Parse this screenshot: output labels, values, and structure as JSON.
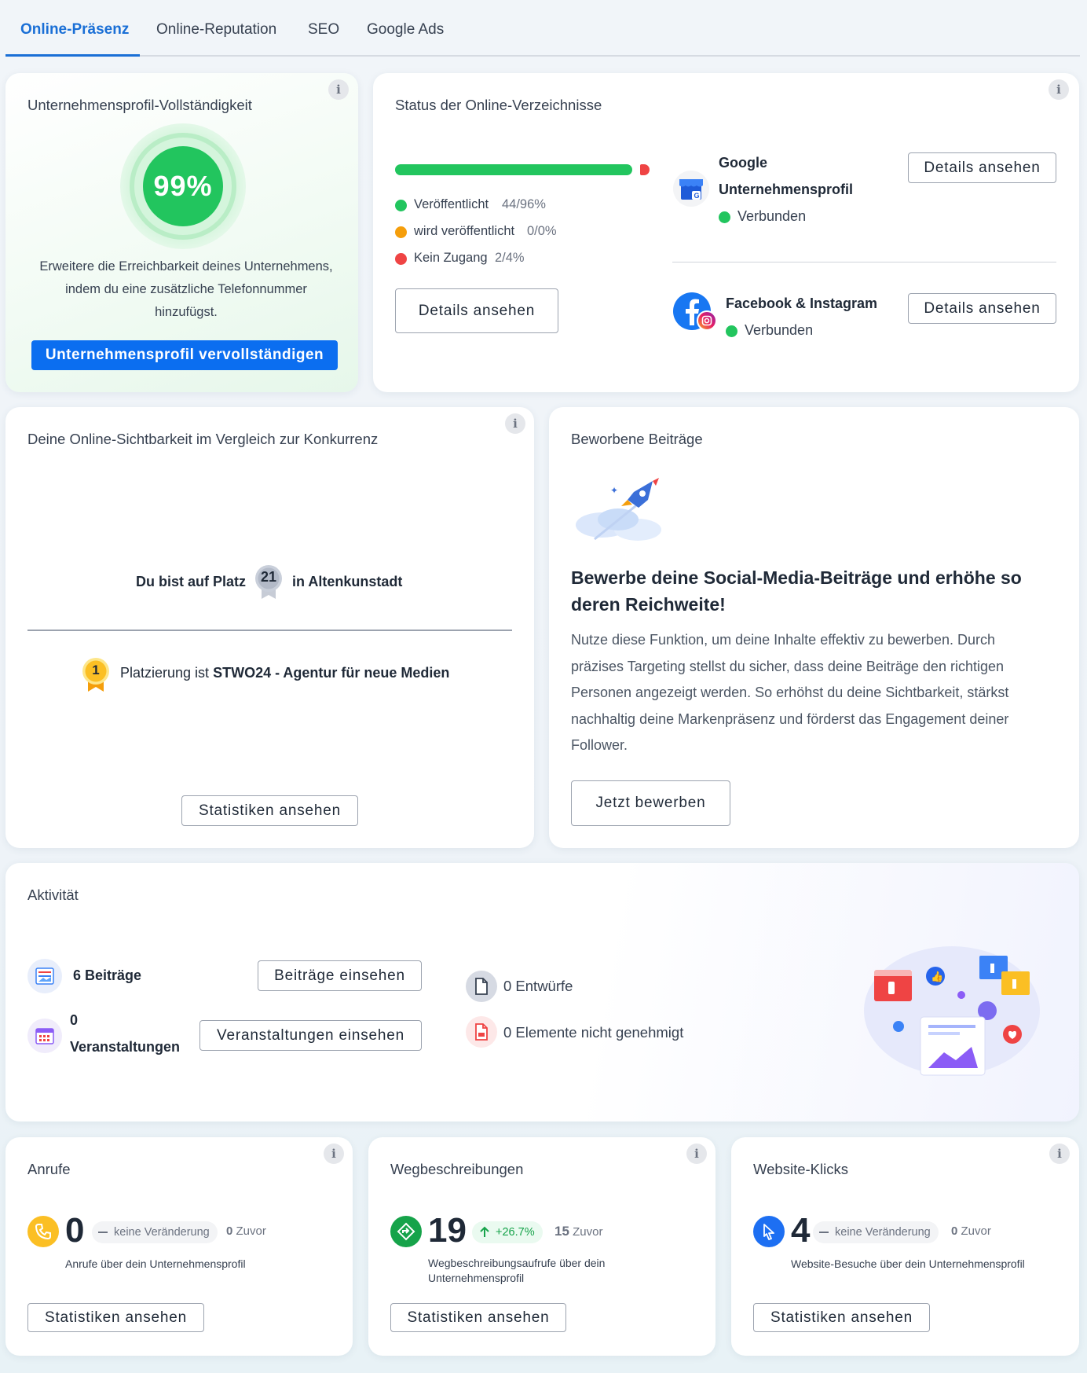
{
  "tabs": [
    {
      "label": "Online-Präsenz",
      "active": true
    },
    {
      "label": "Online-Reputation"
    },
    {
      "label": "SEO"
    },
    {
      "label": "Google Ads"
    }
  ],
  "profile": {
    "title": "Unternehmensprofil-Vollständigkeit",
    "percent": "99%",
    "description_lines": [
      "Erweitere die Erreichbarkeit deines Unternehmens,",
      "indem du eine zusätzliche Telefonnummer",
      "hinzufügst."
    ],
    "cta": "Unternehmensprofil vervollständigen"
  },
  "directories": {
    "title": "Status der Online-Verzeichnisse",
    "progress": {
      "published_pct": 96,
      "no_access_pct": 4
    },
    "legend": [
      {
        "label": "Veröffentlicht",
        "value": "44/96%",
        "color": "#22c55e"
      },
      {
        "label": "wird veröffentlicht",
        "value": "0/0%",
        "color": "#f59e0b"
      },
      {
        "label": "Kein Zugang",
        "value": "2/4%",
        "color": "#ef4444"
      }
    ],
    "details_button": "Details ansehen",
    "google": {
      "name_line1": "Google",
      "name_line2": "Unternehmensprofil",
      "status": "Verbunden",
      "button": "Details ansehen"
    },
    "facebook": {
      "name": "Facebook & Instagram",
      "status": "Verbunden",
      "button": "Details ansehen"
    }
  },
  "visibility": {
    "title": "Deine Online-Sichtbarkeit im Vergleich zur Konkurrenz",
    "rank_prefix": "Du bist auf Platz",
    "rank": "21",
    "rank_suffix": "in Altenkunstadt",
    "top_rank": "1",
    "top_prefix": "Platzierung ist",
    "top_name": "STWO24 - Agentur für neue Medien",
    "button": "Statistiken ansehen"
  },
  "promoted": {
    "title": "Beworbene Beiträge",
    "headline_lines": [
      "Bewerbe deine Social-Media-Beiträge und erhöhe so",
      "deren Reichweite!"
    ],
    "body_lines": [
      "Nutze diese Funktion, um deine Inhalte effektiv zu bewerben. Durch",
      "präzises Targeting stellst du sicher, dass deine Beiträge den richtigen",
      "Personen angezeigt werden. So erhöhst du deine Sichtbarkeit, stärkst",
      "nachhaltig deine Markenpräsenz und förderst das Engagement deiner",
      "Follower."
    ],
    "button": "Jetzt bewerben"
  },
  "activity": {
    "title": "Aktivität",
    "posts": "6 Beiträge",
    "posts_button": "Beiträge einsehen",
    "events_count": "0",
    "events_label": "Veranstaltungen",
    "events_button": "Veranstaltungen einsehen",
    "drafts": "0 Entwürfe",
    "not_approved": "0 Elemente nicht genehmigt"
  },
  "calls": {
    "title": "Anrufe",
    "value": "0",
    "change": "keine Veränderung",
    "prev_value": "0",
    "prev_label": "Zuvor",
    "desc": "Anrufe über dein Unternehmensprofil",
    "button": "Statistiken ansehen"
  },
  "directions": {
    "title": "Wegbeschreibungen",
    "value": "19",
    "change": "+26.7%",
    "prev_value": "15",
    "prev_label": "Zuvor",
    "desc_lines": [
      "Wegbeschreibungsaufrufe über dein",
      "Unternehmensprofil"
    ],
    "button": "Statistiken ansehen"
  },
  "clicks": {
    "title": "Website-Klicks",
    "value": "4",
    "change": "keine Veränderung",
    "prev_value": "0",
    "prev_label": "Zuvor",
    "desc": "Website-Besuche über dein Unternehmensprofil",
    "button": "Statistiken ansehen"
  },
  "colors": {
    "accent": "#1a6fd6",
    "green": "#22c55e",
    "orange": "#f59e0b",
    "red": "#ef4444"
  }
}
